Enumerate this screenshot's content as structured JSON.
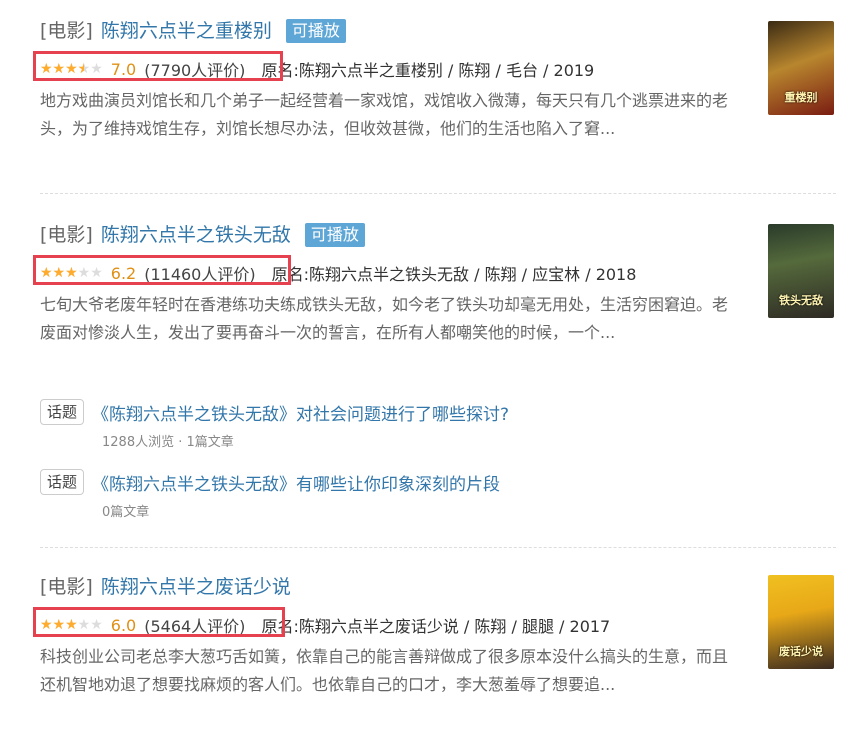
{
  "results": [
    {
      "category": "[电影]",
      "title": "陈翔六点半之重楼别",
      "playable_label": "可播放",
      "rating_fraction": 0.7,
      "score": "7.0",
      "votes": "(7790人评价)",
      "subject": "原名:陈翔六点半之重楼别 / 陈翔 / 毛台 / 2019",
      "abstract": "地方戏曲演员刘馆长和几个弟子一起经营着一家戏馆，戏馆收入微薄，每天只有几个逃票进来的老头，为了维持戏馆生存，刘馆长想尽办法，但收效甚微，他们的生活也陷入了窘...",
      "poster_text": "重楼别"
    },
    {
      "category": "[电影]",
      "title": "陈翔六点半之铁头无敌",
      "playable_label": "可播放",
      "rating_fraction": 0.6,
      "score": "6.2",
      "votes": "(11460人评价)",
      "subject": "原名:陈翔六点半之铁头无敌 / 陈翔 / 应宝林 / 2018",
      "abstract": "七旬大爷老废年轻时在香港练功夫练成铁头无敌，如今老了铁头功却毫无用处，生活穷困窘迫。老废面对惨淡人生，发出了要再奋斗一次的誓言，在所有人都嘲笑他的时候，一个...",
      "poster_text": "铁头无敌"
    },
    {
      "category": "[电影]",
      "title": "陈翔六点半之废话少说",
      "rating_fraction": 0.6,
      "score": "6.0",
      "votes": "(5464人评价)",
      "subject": "原名:陈翔六点半之废话少说 / 陈翔 / 腿腿 / 2017",
      "abstract": "科技创业公司老总李大葱巧舌如簧，依靠自己的能言善辩做成了很多原本没什么搞头的生意，而且还机智地劝退了想要找麻烦的客人们。也依靠自己的口才，李大葱羞辱了想要追...",
      "poster_text": "废话少说"
    }
  ],
  "topics": [
    {
      "tag": "话题",
      "title": "《陈翔六点半之铁头无敌》对社会问题进行了哪些探讨?",
      "meta": "1288人浏览 · 1篇文章"
    },
    {
      "tag": "话题",
      "title": "《陈翔六点半之铁头无敌》有哪些让你印象深刻的片段",
      "meta": "0篇文章"
    }
  ],
  "stars_glyph": "★★★★★",
  "colors": {
    "link": "#3377aa",
    "star": "#ffac2d",
    "highlight_box": "#e5414f",
    "playable_bg": "#5ea6d6"
  }
}
